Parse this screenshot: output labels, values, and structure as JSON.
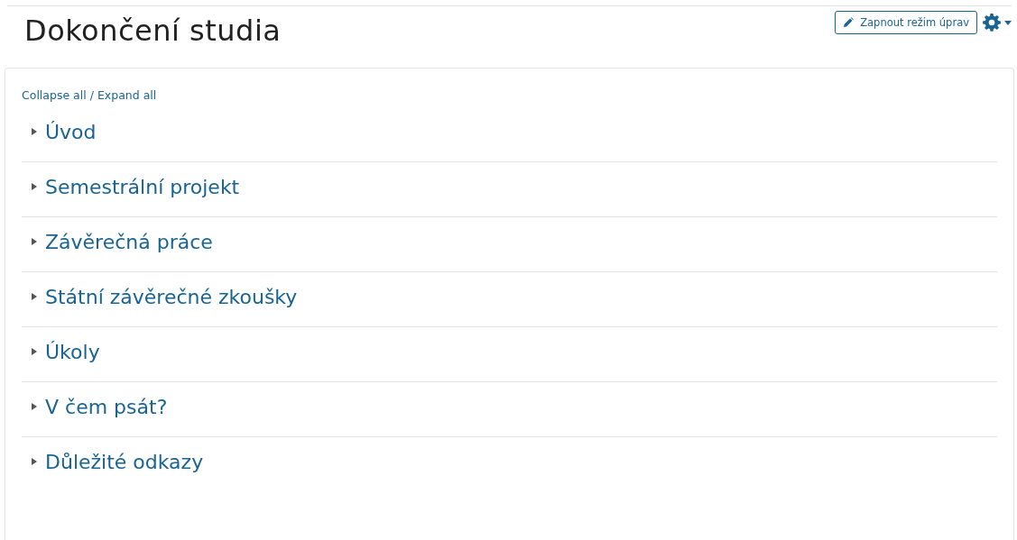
{
  "page": {
    "title": "Dokončení studia"
  },
  "edit_button": {
    "label": "Zapnout režim úprav"
  },
  "toggles": {
    "collapse": "Collapse all",
    "separator": "/",
    "expand": "Expand all"
  },
  "sections": [
    {
      "title": "Úvod",
      "expanded": false
    },
    {
      "title": "Semestrální projekt",
      "expanded": false
    },
    {
      "title": "Závěrečná práce",
      "expanded": false
    },
    {
      "title": "Státní závěrečné zkoušky",
      "expanded": false
    },
    {
      "title": "Úkoly",
      "expanded": false
    },
    {
      "title": "V čem psát?",
      "expanded": false
    },
    {
      "title": "Důležité odkazy",
      "expanded": false
    }
  ]
}
